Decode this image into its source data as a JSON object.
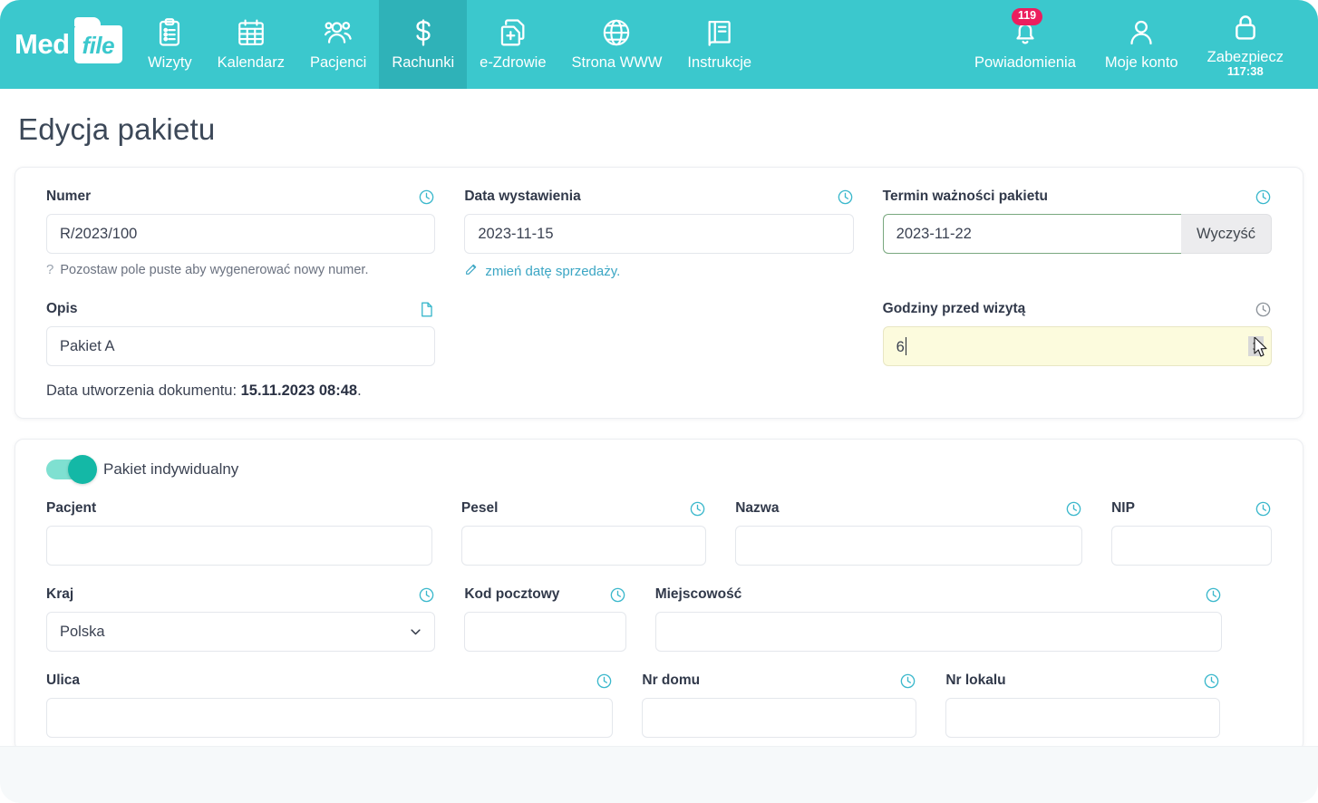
{
  "brand": {
    "med": "Med",
    "file": "file"
  },
  "nav": {
    "items": [
      {
        "label": "Wizyty",
        "icon": "clipboard-icon",
        "active": false
      },
      {
        "label": "Kalendarz",
        "icon": "calendar-icon",
        "active": false
      },
      {
        "label": "Pacjenci",
        "icon": "users-icon",
        "active": false
      },
      {
        "label": "Rachunki",
        "icon": "dollar-icon",
        "active": true
      },
      {
        "label": "e-Zdrowie",
        "icon": "health-docs-icon",
        "active": false
      },
      {
        "label": "Strona WWW",
        "icon": "globe-icon",
        "active": false
      },
      {
        "label": "Instrukcje",
        "icon": "book-icon",
        "active": false
      }
    ],
    "right": {
      "notifications_label": "Powiadomienia",
      "notifications_count": "119",
      "account_label": "Moje konto",
      "secure_label": "Zabezpiecz",
      "secure_timer": "117:38"
    },
    "accent": "#3bc8cd",
    "active_bg": "#2fb2b8",
    "badge_color": "#ec1e5e"
  },
  "page": {
    "title": "Edycja pakietu"
  },
  "card1": {
    "numer": {
      "label": "Numer",
      "value": "R/2023/100",
      "placeholder": "",
      "helper_mark": "?",
      "helper": "Pozostaw pole puste aby wygenerować nowy numer."
    },
    "data_wystawienia": {
      "label": "Data wystawienia",
      "value": "2023-11-15",
      "link": "zmień datę sprzedaży."
    },
    "termin": {
      "label": "Termin ważności pakietu",
      "value": "2023-11-22",
      "clear_button": "Wyczyść"
    },
    "opis": {
      "label": "Opis",
      "value": "Pakiet A"
    },
    "godziny": {
      "label": "Godziny przed wizytą",
      "value": "6"
    },
    "created": {
      "prefix": "Data utworzenia dokumentu: ",
      "value": "15.11.2023 08:48",
      "suffix": "."
    }
  },
  "card2": {
    "toggle": {
      "label": "Pakiet indywidualny",
      "on": true
    },
    "fields": [
      {
        "label": "Pacjent",
        "value": "",
        "icon": null,
        "width": "c-33"
      },
      {
        "label": "Pesel",
        "value": "",
        "icon": "clock-icon",
        "width": "c-22"
      },
      {
        "label": "Nazwa",
        "value": "",
        "icon": "clock-icon",
        "width": "c-30"
      },
      {
        "label": "NIP",
        "value": "",
        "icon": "clock-icon",
        "width": "c-15"
      },
      {
        "label": "Kraj",
        "value": "Polska",
        "icon": "clock-icon",
        "width": "c-33"
      },
      {
        "label": "Kod pocztowy",
        "value": "",
        "icon": "clock-icon",
        "width": "c-15"
      },
      {
        "label": "Miejscowość",
        "value": "",
        "icon": "clock-icon",
        "width": "c-47"
      },
      {
        "label": "Ulica",
        "value": "",
        "icon": "clock-icon",
        "width": "c-47"
      },
      {
        "label": "Nr domu",
        "value": "",
        "icon": "clock-icon",
        "width": "c-24"
      },
      {
        "label": "Nr lokalu",
        "value": "",
        "icon": "clock-icon",
        "width": "c-24"
      }
    ],
    "kraj_selected": "Polska"
  }
}
